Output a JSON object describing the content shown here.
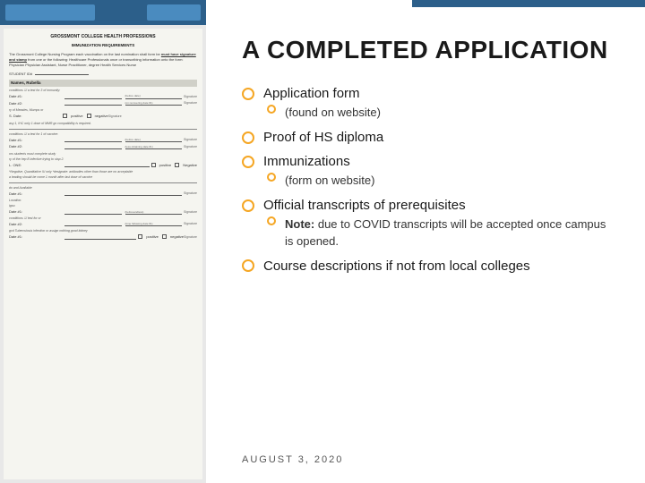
{
  "leftPanel": {
    "header": {
      "title": "GROSSMONT COLLEGE HEALTH PROFESSIONS",
      "subtitle": "IMMUNIZATION REQUIREMENTS"
    },
    "intro": "The Grossmont College Nursing Program each vaccination on the last nomination shall form be must have signature and stamp from one of the following: Healthcare Professionals once or transcribing information onto the form: Physician Physician Assistant, Nurse Practitioner, degree Health Services Nurse",
    "studentLabel": "STUDENT ID#:",
    "sections": [
      {
        "title": "Mumps, Rubella",
        "date1Label": "Date #1:",
        "date2Label": "Date #2:",
        "dateNote": "(before date)",
        "sigLabel": "Signature"
      }
    ]
  },
  "rightPanel": {
    "title": "A COMPLETED APPLICATION",
    "items": [
      {
        "id": "application-form",
        "label": "Application form",
        "subItems": [
          {
            "id": "found-on-website",
            "text": "(found on website)"
          }
        ]
      },
      {
        "id": "proof-hs-diploma",
        "label": "Proof of HS diploma",
        "subItems": []
      },
      {
        "id": "immunizations",
        "label": "Immunizations",
        "subItems": [
          {
            "id": "form-on-website",
            "text": "(form on website)"
          }
        ]
      },
      {
        "id": "official-transcripts",
        "label": "Official transcripts of prerequisites",
        "subItems": [
          {
            "id": "covid-note",
            "text": "Note:  due to COVID transcripts will be accepted once campus is opened."
          }
        ]
      },
      {
        "id": "course-descriptions",
        "label": "Course descriptions if not from local colleges",
        "subItems": []
      }
    ],
    "footer": {
      "date": "AUGUST 3, 2020"
    }
  },
  "colors": {
    "accent": "#f5a623",
    "headerBlue": "#2c5f8a",
    "text": "#1a1a1a",
    "subtext": "#333333"
  }
}
